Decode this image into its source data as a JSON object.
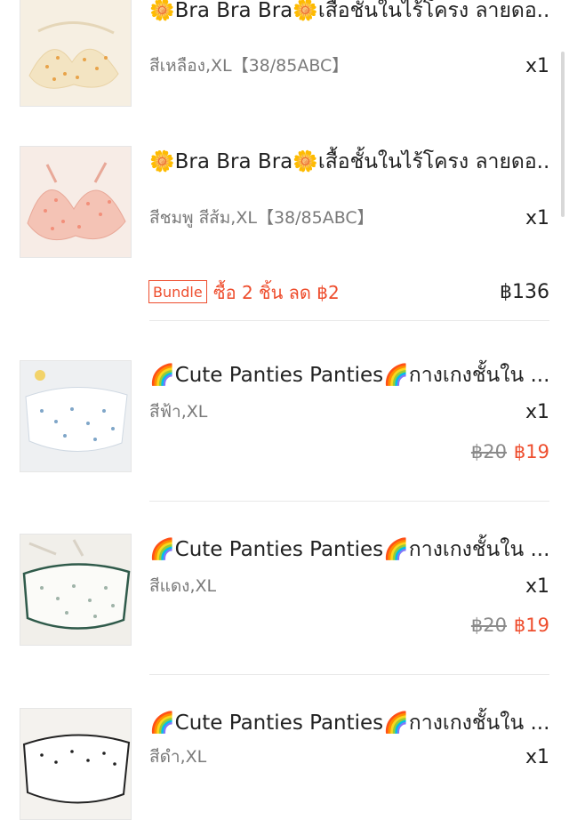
{
  "items": [
    {
      "title": "🌼Bra Bra Bra🌼เสื้อชั้นในไร้โครง ลายดอ...",
      "variant": "สีเหลือง,XL【38/85ABC】",
      "qty": "x1",
      "thumb_color": "#f3e6c9"
    },
    {
      "title": "🌼Bra Bra Bra🌼เสื้อชั้นในไร้โครง ลายดอ...",
      "variant": "สีชมพู สีส้ม,XL【38/85ABC】",
      "qty": "x1",
      "thumb_color": "#f4c9bf"
    },
    {
      "title": "🌈Cute Panties Panties🌈กางเกงชั้นใน ...",
      "variant": "สีฟ้า,XL",
      "qty": "x1",
      "price_old": "฿20",
      "price_new": "฿19",
      "thumb_color": "#eef2f6"
    },
    {
      "title": "🌈Cute Panties Panties🌈กางเกงชั้นใน ...",
      "variant": "สีแดง,XL",
      "qty": "x1",
      "price_old": "฿20",
      "price_new": "฿19",
      "thumb_color": "#f2f0ea"
    },
    {
      "title": "🌈Cute Panties Panties🌈กางเกงชั้นใน ...",
      "variant": "สีดำ,XL",
      "qty": "x1",
      "thumb_color": "#f4f2ee"
    }
  ],
  "bundle": {
    "tag": "Bundle",
    "offer": "ซื้อ 2 ชิ้น ลด ฿2",
    "total": "฿136"
  },
  "colors": {
    "accent": "#ee4d2d",
    "muted_text": "#7a7a7a",
    "divider": "#e8e8e8"
  }
}
